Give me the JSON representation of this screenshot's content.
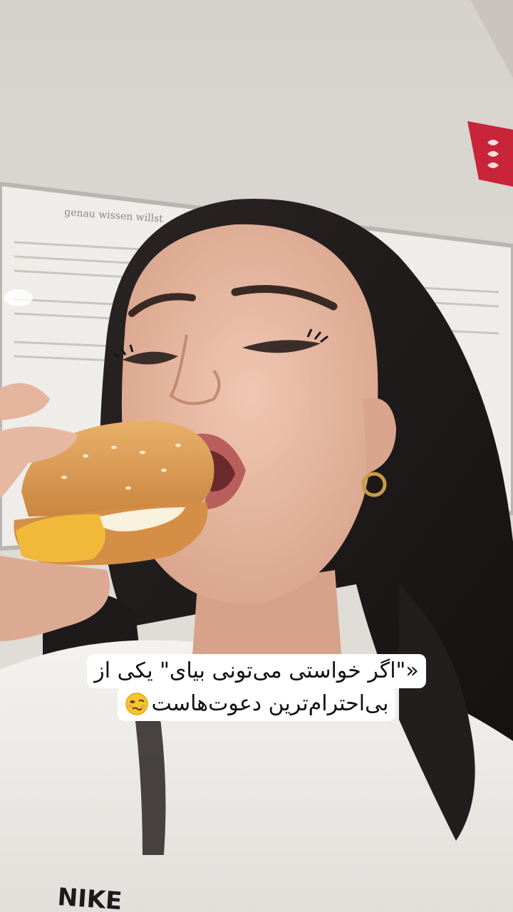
{
  "caption": {
    "line1": "«\"اگر خواستی می‌تونی بیای\" یکی از",
    "line2": "بی‌احترام‌ترین دعوت‌هاست",
    "emoji": "woozy-face-emoji"
  },
  "shirt_text": "NIKE",
  "board_heading": "genau wissen willst",
  "colors": {
    "caption_bg": "#ffffff",
    "caption_text": "#111111",
    "wall": "#d9d5d0",
    "sign": "#c8243a",
    "hair": "#1e1a1a",
    "skin": "#e6b8a2",
    "bun": "#d99a55",
    "shirt": "#efedea"
  }
}
